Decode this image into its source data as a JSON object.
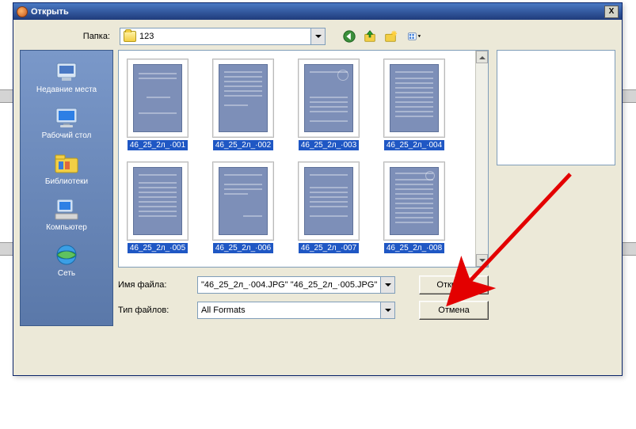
{
  "window": {
    "title": "Открыть",
    "close_label": "X"
  },
  "folder": {
    "label": "Папка:",
    "current": "123"
  },
  "places": {
    "recent": "Недавние места",
    "desktop": "Рабочий стол",
    "libraries": "Библиотеки",
    "computer": "Компьютер",
    "network": "Сеть"
  },
  "files": [
    {
      "label": "46_25_2л_·001"
    },
    {
      "label": "46_25_2л_·002"
    },
    {
      "label": "46_25_2л_·003"
    },
    {
      "label": "46_25_2л_·004"
    },
    {
      "label": "46_25_2л_·005"
    },
    {
      "label": "46_25_2л_·006"
    },
    {
      "label": "46_25_2л_·007"
    },
    {
      "label": "46_25_2л_·008"
    }
  ],
  "filename": {
    "label": "Имя файла:",
    "value": "\"46_25_2л_·004.JPG\" \"46_25_2л_·005.JPG\""
  },
  "filetype": {
    "label": "Тип файлов:",
    "value": "All Formats"
  },
  "buttons": {
    "open": "Открыть",
    "cancel": "Отмена"
  }
}
